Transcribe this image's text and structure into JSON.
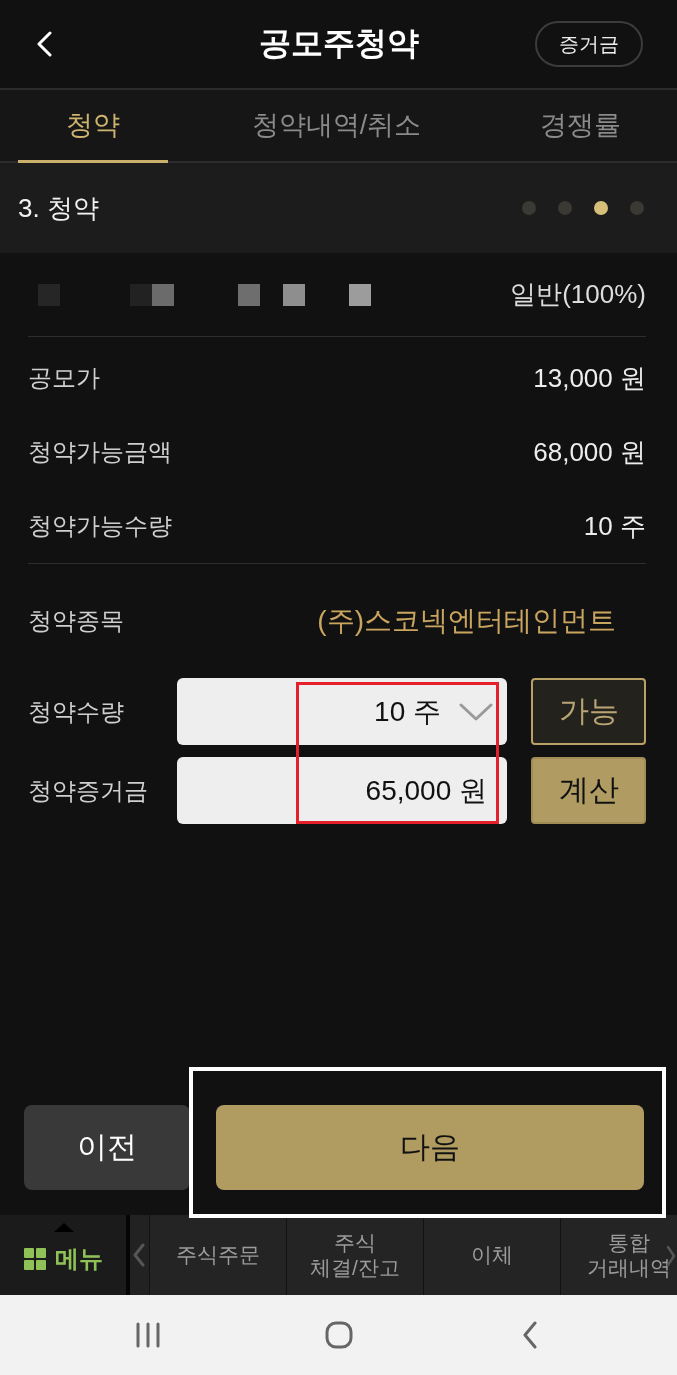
{
  "header": {
    "title": "공모주청약",
    "deposit_button": "증거금"
  },
  "tabs": [
    {
      "label": "청약",
      "selected": true
    },
    {
      "label": "청약내역/취소",
      "selected": false
    },
    {
      "label": "경쟁률",
      "selected": false
    }
  ],
  "step": {
    "title": "3. 청약",
    "dots": [
      {
        "selected": false
      },
      {
        "selected": false
      },
      {
        "selected": true
      },
      {
        "selected": false
      }
    ]
  },
  "account": {
    "type": "일반(100%)"
  },
  "info_rows": [
    {
      "label": "공모가",
      "value": "13,000 원"
    },
    {
      "label": "청약가능금액",
      "value": "68,000 원"
    },
    {
      "label": "청약가능수량",
      "value": "10 주"
    }
  ],
  "stock": {
    "label": "청약종목",
    "value": "(주)스코넥엔터테인먼트"
  },
  "form_rows": [
    {
      "kind": "select",
      "label": "청약수량",
      "value": "10 주",
      "button": "가능"
    },
    {
      "kind": "input",
      "label": "청약증거금",
      "value": "65,000 원",
      "button": "계산"
    }
  ],
  "actions": {
    "previous": "이전",
    "next": "다음"
  },
  "annotation_frames": [
    {
      "color": "#e5202b"
    },
    {
      "color": "#ffffff"
    }
  ],
  "bottom_nav": {
    "menu": "메뉴",
    "items": [
      "주식주문",
      "주식\n체결/잔고",
      "이체",
      "통합\n거래내역"
    ]
  }
}
